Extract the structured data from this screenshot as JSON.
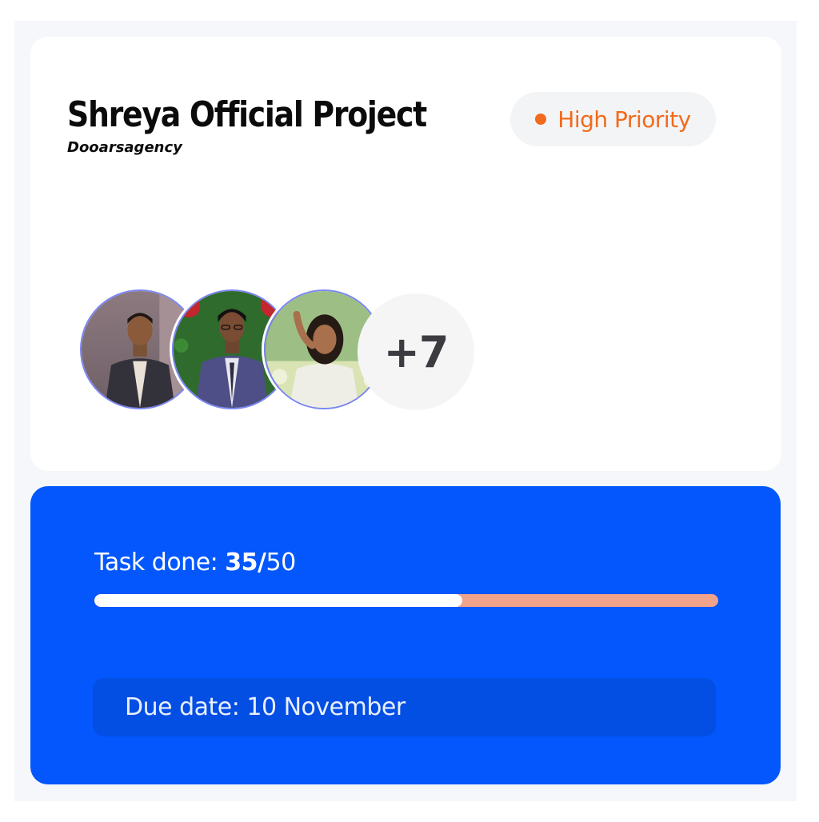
{
  "project": {
    "title": "Shreya Official Project",
    "agency": "Dooarsagency",
    "priority_label": "High Priority",
    "priority_color": "#f26a1b"
  },
  "team": {
    "members": [
      {
        "avatar": "person-photo"
      },
      {
        "avatar": "person-photo"
      },
      {
        "avatar": "person-photo"
      }
    ],
    "more_count": "+7"
  },
  "progress": {
    "label": "Task done: ",
    "done": "35",
    "separator": "/",
    "total": "50",
    "fraction": 0.59,
    "fill_color": "#ffffff",
    "track_color": "#f0a38a"
  },
  "due": {
    "text": "Due date: 10 November"
  },
  "colors": {
    "accent": "#0357fc"
  }
}
